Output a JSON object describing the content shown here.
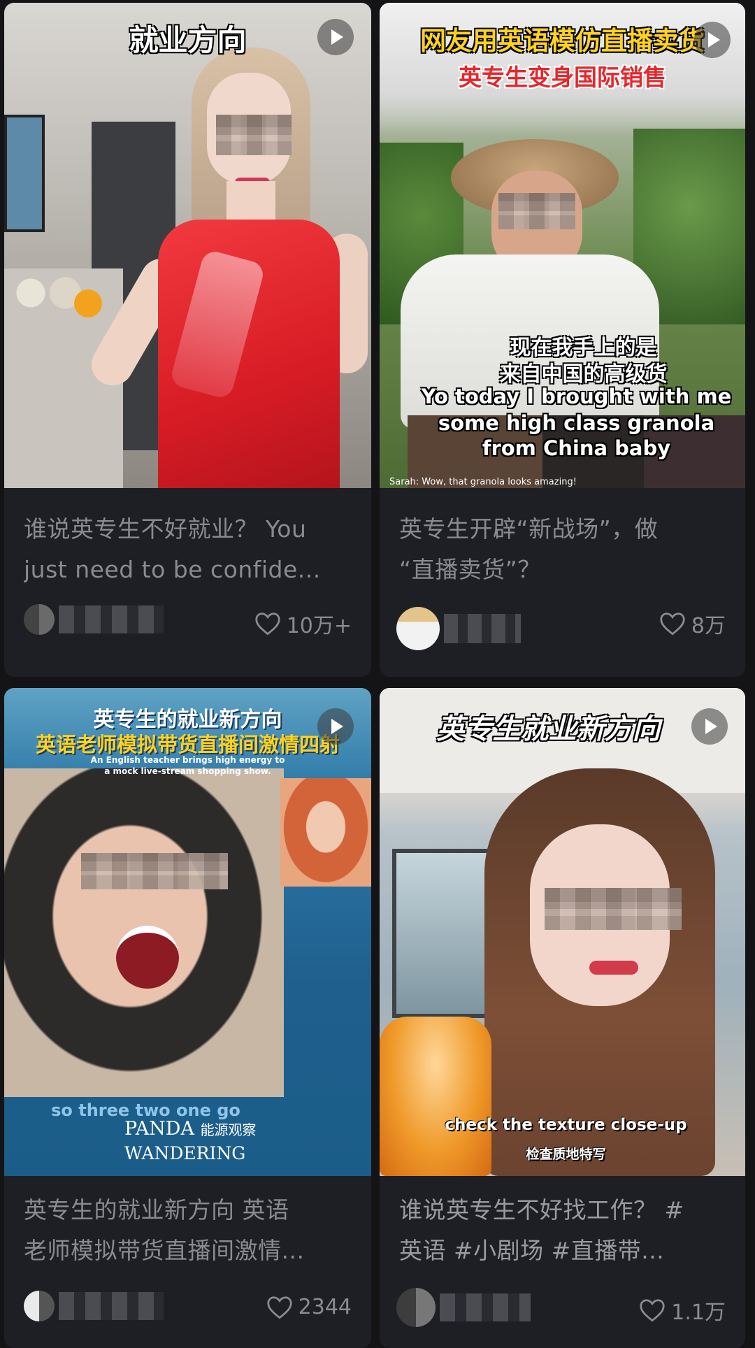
{
  "feed": {
    "cards": [
      {
        "overlay_caption": "就业方向",
        "title_line1": "谁说英专生不好就业？ You",
        "title_line2": "just need to be confide...",
        "likes": "10万+"
      },
      {
        "overlay_top1": "网友用英语模仿直播卖货",
        "overlay_top2": "英专生变身国际销售",
        "subtitle_cn1": "现在我手上的是",
        "subtitle_cn2": "来自中国的高级货",
        "subtitle_en1": "Yo today I brought with me",
        "subtitle_en2": "some high class granola",
        "subtitle_en3": "from China baby",
        "small_caption": "Sarah: Wow, that granola looks amazing!",
        "title_line1": "英专生开辟“新战场”，做",
        "title_line2": "“直播卖货”？",
        "likes": "8万"
      },
      {
        "overlay_top1": "英专生的就业新方向",
        "overlay_top2": "英语老师模拟带货直播间激情四射",
        "overlay_en1": "An English teacher brings high energy to",
        "overlay_en2": "a mock live-stream shopping show.",
        "subtitle_bottom": "so three two one go",
        "logo_main": "PANDA",
        "logo_cn": "能源观察",
        "logo_main2": "WANDERING",
        "title_line1": "英专生的就业新方向 英语",
        "title_line2": "老师模拟带货直播间激情...",
        "likes": "2344"
      },
      {
        "overlay_caption": "英专生就业新方向",
        "subtitle_en": "check the texture close-up",
        "subtitle_cn": "检查质地特写",
        "title_line1": "谁说英专生不好找工作？ #",
        "title_line2": "英语 #小剧场 #直播带...",
        "likes": "1.1万"
      }
    ]
  },
  "colors": {
    "background": "#141416",
    "card": "#1e1f24",
    "text_muted": "#8a8b90",
    "red_caption": "#e8262b",
    "yellow_caption": "#ffd21e"
  }
}
